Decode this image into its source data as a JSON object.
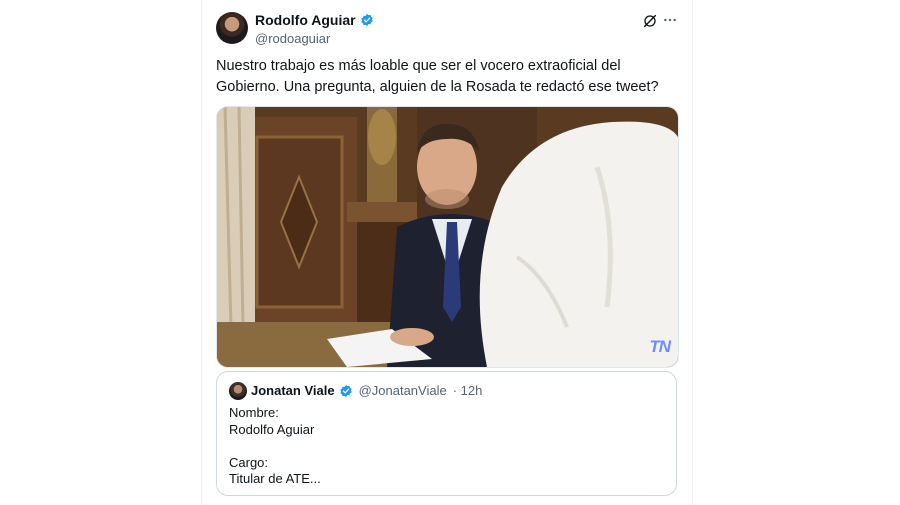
{
  "author": {
    "name": "Rodolfo Aguiar",
    "handle": "@rodoaguiar"
  },
  "tweet": {
    "text": "Nuestro trabajo es más loable que ser el vocero extraoficial del Gobierno. Una pregunta, alguien de la Rosada te redactó ese tweet?"
  },
  "media": {
    "watermark": "TN"
  },
  "quoted": {
    "name": "Jonatan Viale",
    "handle": "@JonatanViale",
    "time": "· 12h",
    "lines": [
      "Nombre:",
      "Rodolfo Aguiar",
      "",
      "Cargo:",
      "Titular de ATE..."
    ]
  },
  "icons": {
    "verified": "verified-badge-icon",
    "grok": "grok-icon",
    "more": "more-options-icon"
  },
  "colors": {
    "verified": "#1d9bf0",
    "text": "#0f1419",
    "secondary": "#536471"
  }
}
